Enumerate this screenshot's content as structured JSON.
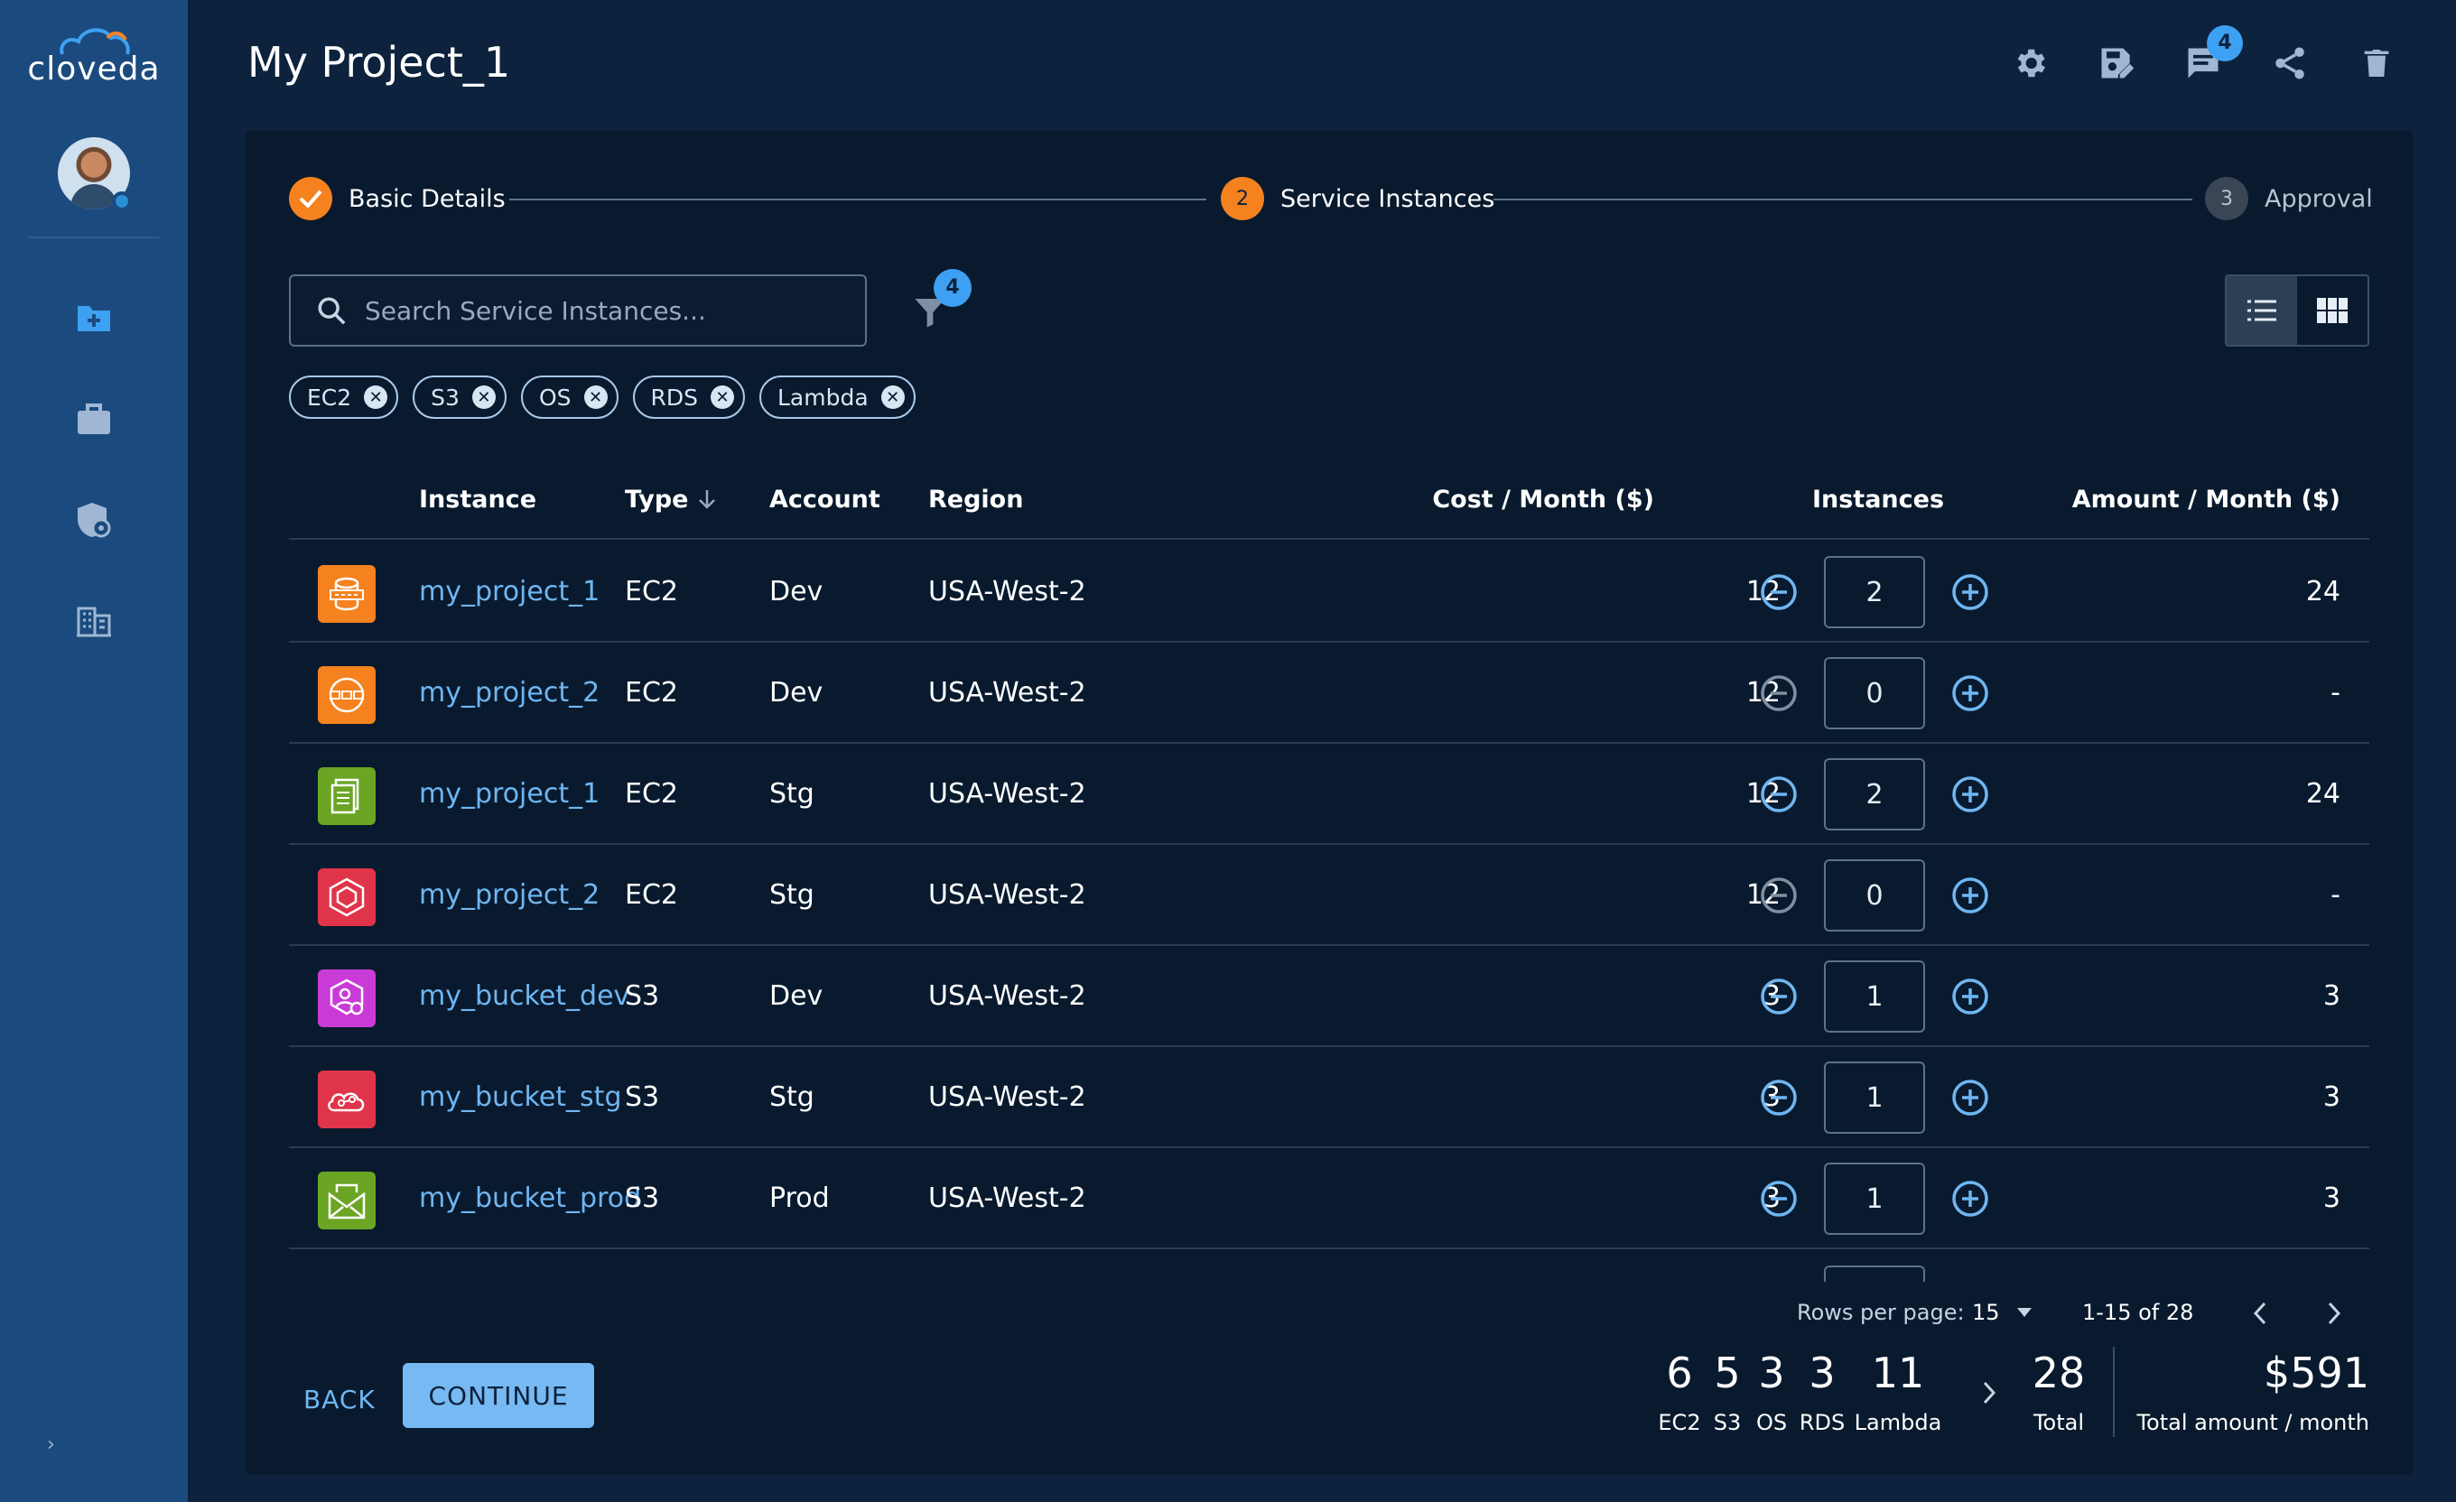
{
  "app": {
    "logo_text": "cloveda",
    "title": "My Project_1"
  },
  "header": {
    "messages_badge": "4",
    "icons": [
      "gear-icon",
      "save-edit-icon",
      "message-icon",
      "share-icon",
      "trash-icon"
    ]
  },
  "sidebar": {
    "items": [
      "new-folder-icon",
      "briefcase-icon",
      "security-icon",
      "building-icon"
    ],
    "expand_glyph": "›"
  },
  "stepper": {
    "steps": [
      {
        "number": "✓",
        "label": "Basic Details",
        "state": "done"
      },
      {
        "number": "2",
        "label": "Service Instances",
        "state": "active"
      },
      {
        "number": "3",
        "label": "Approval",
        "state": "pending"
      }
    ]
  },
  "search": {
    "placeholder": "Search Service Instances..."
  },
  "filter": {
    "badge": "4"
  },
  "chips": [
    "EC2",
    "S3",
    "OS",
    "RDS",
    "Lambda"
  ],
  "table": {
    "headers": {
      "instance": "Instance",
      "type": "Type",
      "account": "Account",
      "region": "Region",
      "cost": "Cost / Month ($)",
      "instances": "Instances",
      "amount": "Amount / Month ($)"
    },
    "rows": [
      {
        "icon": "orange-db-icon",
        "instance": "my_project_1",
        "type": "EC2",
        "account": "Dev",
        "region": "USA-West-2",
        "cost": "12",
        "qty": "2",
        "amount": "24"
      },
      {
        "icon": "orange-network-icon",
        "instance": "my_project_2",
        "type": "EC2",
        "account": "Dev",
        "region": "USA-West-2",
        "cost": "12",
        "qty": "0",
        "amount": "-"
      },
      {
        "icon": "green-document-icon",
        "instance": "my_project_1",
        "type": "EC2",
        "account": "Stg",
        "region": "USA-West-2",
        "cost": "12",
        "qty": "2",
        "amount": "24"
      },
      {
        "icon": "red-cube-icon",
        "instance": "my_project_2",
        "type": "EC2",
        "account": "Stg",
        "region": "USA-West-2",
        "cost": "12",
        "qty": "0",
        "amount": "-"
      },
      {
        "icon": "magenta-user-gear-icon",
        "instance": "my_bucket_dev",
        "type": "S3",
        "account": "Dev",
        "region": "USA-West-2",
        "cost": "3",
        "qty": "1",
        "amount": "3"
      },
      {
        "icon": "red-cloud-icon",
        "instance": "my_bucket_stg",
        "type": "S3",
        "account": "Stg",
        "region": "USA-West-2",
        "cost": "3",
        "qty": "1",
        "amount": "3"
      },
      {
        "icon": "green-mail-icon",
        "instance": "my_bucket_prod",
        "type": "S3",
        "account": "Prod",
        "region": "USA-West-2",
        "cost": "3",
        "qty": "1",
        "amount": "3"
      }
    ]
  },
  "pagination": {
    "rows_per_page_label": "Rows per page:",
    "rows_per_page": "15",
    "range": "1-15 of 28"
  },
  "footer": {
    "back_label": "BACK",
    "continue_label": "CONTINUE",
    "counts": [
      {
        "value": "6",
        "label": "EC2"
      },
      {
        "value": "5",
        "label": "S3"
      },
      {
        "value": "3",
        "label": "OS"
      },
      {
        "value": "3",
        "label": "RDS"
      },
      {
        "value": "11",
        "label": "Lambda"
      }
    ],
    "total": {
      "value": "28",
      "label": "Total"
    },
    "amount": {
      "value": "$591",
      "label": "Total amount / month"
    }
  },
  "colors": {
    "accent_orange": "#f5821f",
    "link_blue": "#6fb6f2",
    "badge_blue": "#3ea0f2",
    "sidebar": "#1b4a7e"
  }
}
